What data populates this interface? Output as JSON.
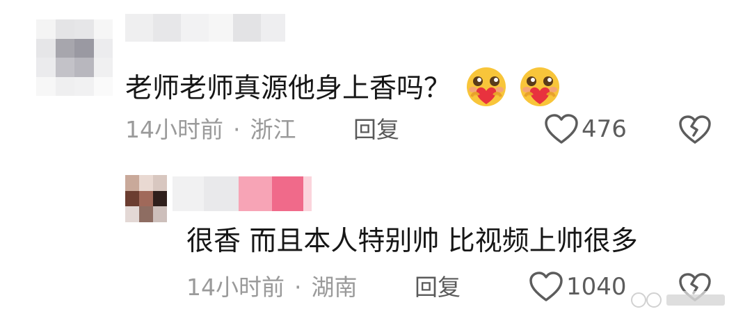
{
  "comments": [
    {
      "text": "老师老师真源他身上香吗？",
      "emoji": [
        "heart-hug-emoji",
        "heart-hug-emoji"
      ],
      "time": "14小时前",
      "location": "浙江",
      "reply_label": "回复",
      "likes": "476"
    },
    {
      "text": "很香 而且本人特别帅 比视频上帅很多",
      "time": "14小时前",
      "location": "湖南",
      "reply_label": "回复",
      "likes": "1040"
    }
  ],
  "separator": "·",
  "colors": {
    "meta": "#9a9a9a",
    "text": "#161616",
    "username_highlight": "#f38aa0"
  }
}
